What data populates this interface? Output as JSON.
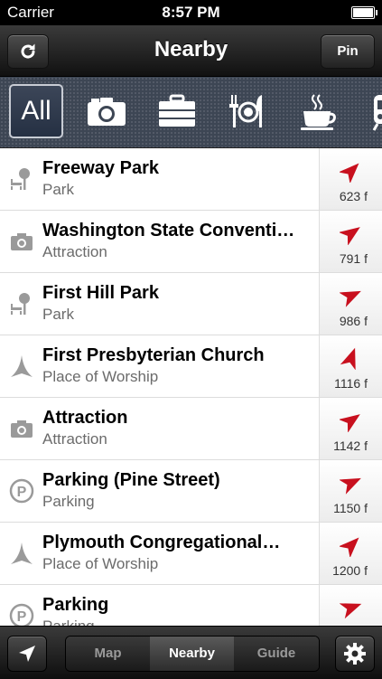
{
  "status": {
    "carrier": "Carrier",
    "time": "8:57 PM"
  },
  "nav": {
    "title": "Nearby",
    "pin_label": "Pin"
  },
  "categories": [
    {
      "label": "All",
      "icon": "all"
    },
    {
      "icon": "camera-icon"
    },
    {
      "icon": "briefcase-icon"
    },
    {
      "icon": "dining-icon"
    },
    {
      "icon": "coffee-icon"
    },
    {
      "icon": "train-icon"
    }
  ],
  "places": [
    {
      "name": "Freeway Park",
      "type": "Park",
      "distance": "623 f",
      "icon": "park-icon",
      "bearing": 45
    },
    {
      "name": "Washington State Conventi…",
      "type": "Attraction",
      "distance": "791 f",
      "icon": "camera-icon",
      "bearing": 55
    },
    {
      "name": "First Hill Park",
      "type": "Park",
      "distance": "986 f",
      "icon": "park-icon",
      "bearing": 65
    },
    {
      "name": "First Presbyterian Church",
      "type": "Place of Worship",
      "distance": "1116 f",
      "icon": "worship-icon",
      "bearing": 20
    },
    {
      "name": "Attraction",
      "type": "Attraction",
      "distance": "1142 f",
      "icon": "camera-icon",
      "bearing": 55
    },
    {
      "name": "Parking (Pine Street)",
      "type": "Parking",
      "distance": "1150 f",
      "icon": "parking-icon",
      "bearing": 65
    },
    {
      "name": "Plymouth Congregational…",
      "type": "Place of Worship",
      "distance": "1200 f",
      "icon": "worship-icon",
      "bearing": 45
    },
    {
      "name": "Parking",
      "type": "Parking",
      "distance": "",
      "icon": "parking-icon",
      "bearing": 70
    }
  ],
  "tabs": {
    "map": "Map",
    "nearby": "Nearby",
    "guide": "Guide",
    "active": "Nearby"
  },
  "colors": {
    "arrow": "#c8101e",
    "icon": "#9a9a9a",
    "category_icon": "#ffffff"
  }
}
